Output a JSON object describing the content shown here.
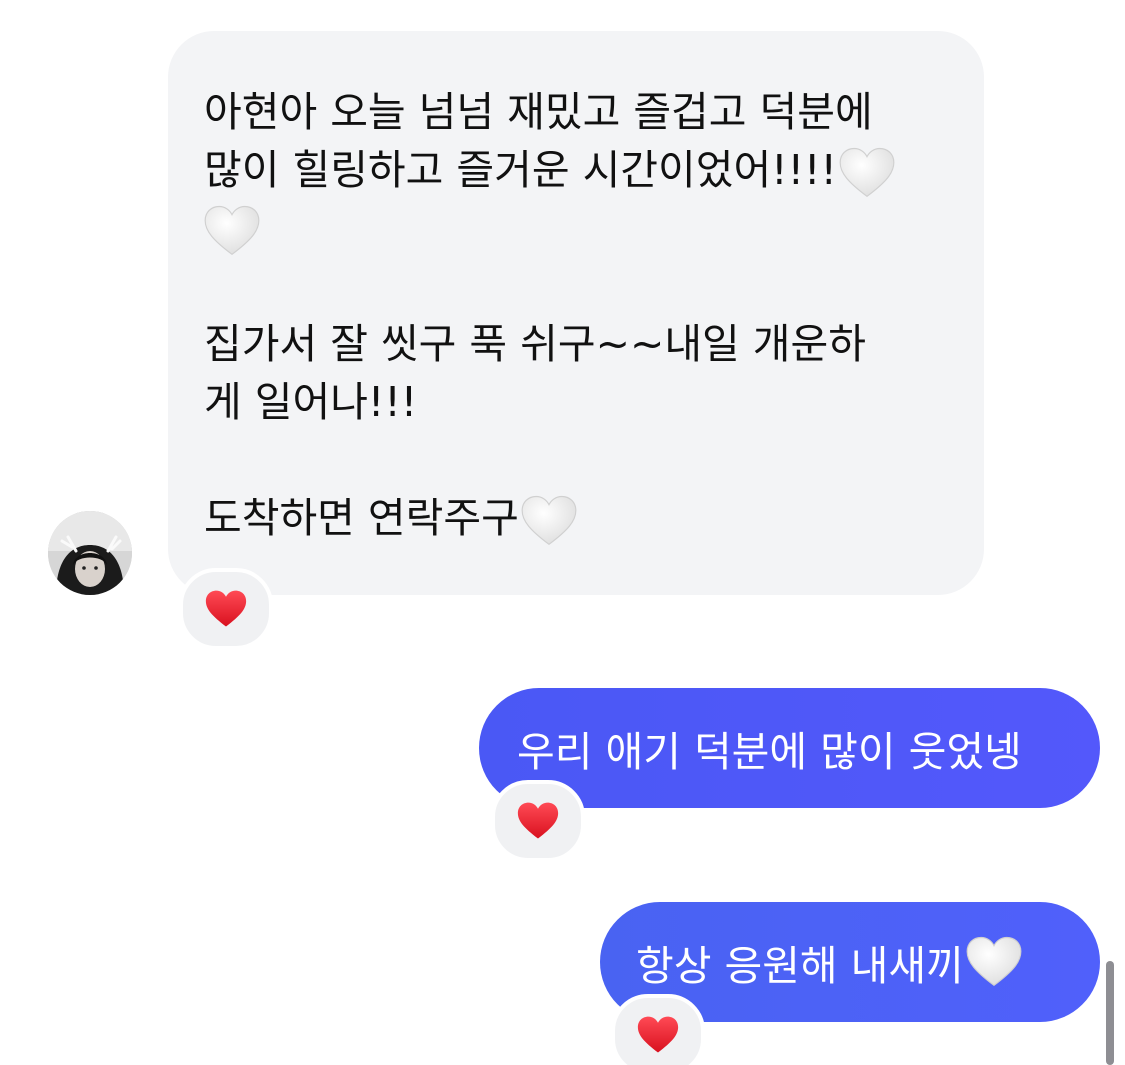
{
  "conversation": {
    "incoming": {
      "lines": [
        "아현아 오늘 넘넘 재밌고 즐겁고 덕분에",
        "많이 힐링하고 즐거운 시간이었어!!!!",
        "",
        "",
        "집가서 잘 씻구  푹 쉬구~~내일 개운하",
        "게 일어나!!!",
        "",
        "도착하면 연락주구"
      ],
      "reaction": "heart"
    },
    "outgoing": [
      {
        "text": "우리 애기 덕분에 많이 웃었넹",
        "reaction": "heart"
      },
      {
        "text": "항상 응원해 내새끼",
        "reaction": "heart"
      }
    ]
  },
  "colors": {
    "incoming_bubble": "#f3f4f6",
    "outgoing_bubble": "#4f5af8",
    "reaction_bg": "#f0f1f3",
    "heart": "#e8192c",
    "white_heart": "#e6e6e6"
  },
  "icons": {
    "reaction": "red-heart-emoji",
    "inline": "white-heart-emoji"
  }
}
